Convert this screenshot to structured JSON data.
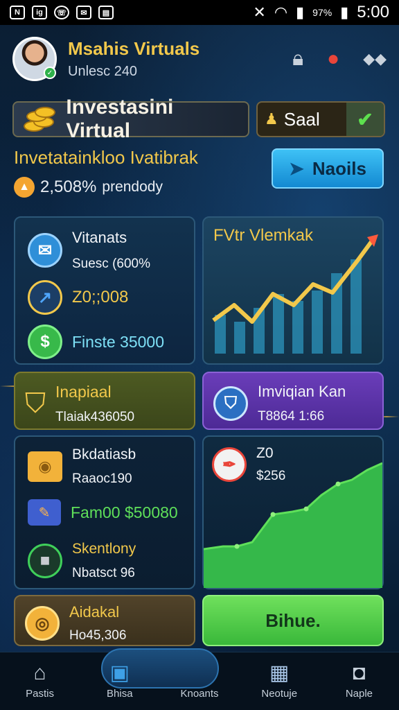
{
  "status_bar": {
    "left_icons": [
      "N",
      "ig",
      "whatsapp",
      "mail",
      "news"
    ],
    "battery": "97%",
    "time": "5:00"
  },
  "header": {
    "name": "Msahis Virtuals",
    "subtitle": "Unlesc 240",
    "icons": [
      "lock-icon",
      "notification-icon",
      "more-icon"
    ]
  },
  "balance": {
    "label": "Investasini Virtual",
    "action_label": "Saal"
  },
  "summary": {
    "title": "Invetatainkloo Ivatibrak",
    "value": "2,508%",
    "unit": "prendody",
    "button_label": "Naoils"
  },
  "cards": {
    "c1": {
      "items": [
        {
          "title": "Vitanats",
          "value": "Suesc (600%"
        },
        {
          "title": "Z0;;008",
          "value": ""
        },
        {
          "title": "Finste 35000",
          "value": ""
        }
      ]
    },
    "c2": {
      "title": "FVtr Vlemkak"
    },
    "c3": {
      "title": "Inapiaal",
      "value": "Tlaiak436050"
    },
    "c4": {
      "title": "Imviqian Kan",
      "value": "T8864 1:66"
    },
    "c5": {
      "items": [
        {
          "title": "Bkdatiasb",
          "value": "Raaoc190"
        },
        {
          "title": "Fam00 $50080",
          "value": ""
        },
        {
          "title": "Skentlony",
          "value": "Nbatsct 96"
        }
      ]
    },
    "c6": {
      "title": "Z0",
      "value": "$256"
    },
    "c7": {
      "title": "Aidakal",
      "value": "Ho45,306"
    },
    "c8": {
      "label": "Bihue."
    }
  },
  "bottom_nav": [
    {
      "label": "Pastis",
      "icon": "home-icon"
    },
    {
      "label": "Bhisa",
      "icon": "bank-icon"
    },
    {
      "label": "Knoants",
      "icon": "house-icon"
    },
    {
      "label": "Neotuje",
      "icon": "calculator-icon"
    },
    {
      "label": "Naple",
      "icon": "camera-icon"
    }
  ],
  "colors": {
    "accent_gold": "#f2c84b",
    "accent_blue": "#3ec1f5",
    "accent_green": "#5fe05a",
    "accent_purple": "#6a3db9"
  }
}
